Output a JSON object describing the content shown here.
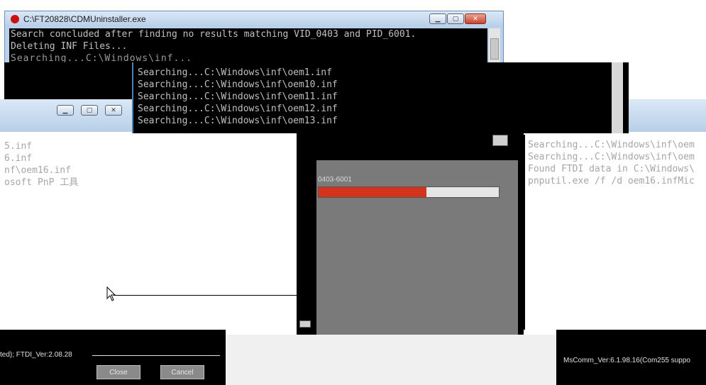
{
  "top_console": {
    "title": "C:\\FT20828\\CDMUninstaller.exe",
    "lines": [
      "Search concluded after finding no results matching VID_0403 and PID_6001.",
      "Deleting INF Files..."
    ]
  },
  "inner_console": {
    "lines": [
      "Searching...C:\\Windows\\inf\\oem1.inf",
      "Searching...C:\\Windows\\inf\\oem10.inf",
      "Searching...C:\\Windows\\inf\\oem11.inf",
      "Searching...C:\\Windows\\inf\\oem12.inf",
      "Searching...C:\\Windows\\inf\\oem13.inf"
    ]
  },
  "left_log": {
    "lines": [
      "5.inf",
      "6.inf",
      "nf\\oem16.inf",
      "osoft PnP 工具"
    ]
  },
  "right_log": {
    "lines": [
      "Searching...C:\\Windows\\inf\\oem",
      "Searching...C:\\Windows\\inf\\oem",
      "Found FTDI data in C:\\Windows\\",
      "pnputil.exe /f /d oem16.infMic"
    ]
  },
  "progress": {
    "label": "0403-6001",
    "fraction": 0.6,
    "fill_color": "#d4341c"
  },
  "bottom_bar": {
    "left_text": "ted); FTDI_Ver:2.08.28",
    "right_text": "MsComm_Ver:6.1.98.16(Com255 suppo",
    "close_label": "Close",
    "cancel_label": "Cancel"
  },
  "colors": {
    "console_bg": "#000000",
    "console_text": "#c0c0c0",
    "panel_gray": "#7a7a7a",
    "close_red": "#c8442f"
  }
}
